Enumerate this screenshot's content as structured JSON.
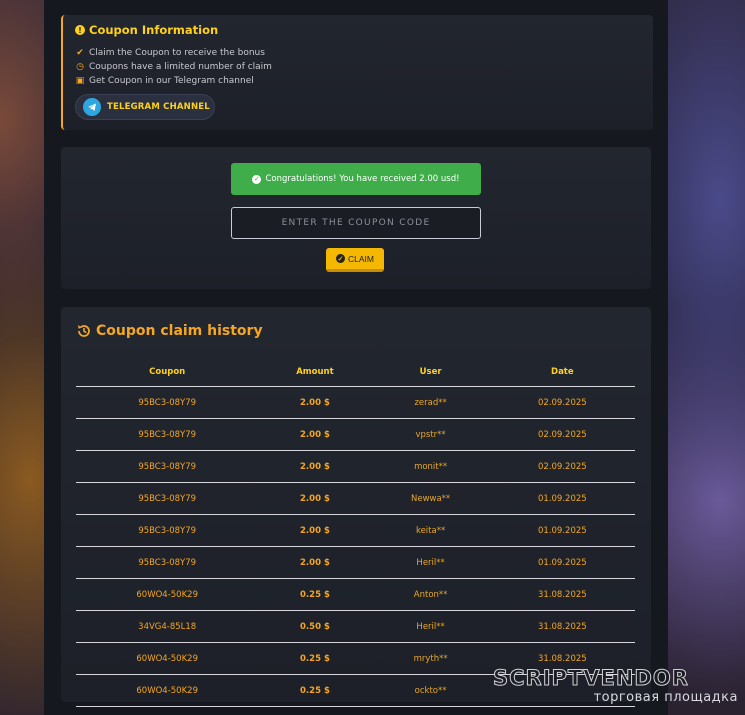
{
  "info": {
    "title": "Coupon Information",
    "lines": [
      {
        "icon": "check-circle-icon",
        "text": "Claim the Coupon to receive the bonus"
      },
      {
        "icon": "clock-icon",
        "text": "Coupons have a limited number of claim"
      },
      {
        "icon": "gift-icon",
        "text": "Get Coupon in our Telegram channel"
      }
    ],
    "telegram_button": "TELEGRAM CHANNEL"
  },
  "claim": {
    "success_message": "Congratulations! You have received 2.00 usd!",
    "input_placeholder": "ENTER THE COUPON CODE",
    "claim_label": "CLAIM"
  },
  "history": {
    "title": "Coupon claim history",
    "columns": [
      "Coupon",
      "Amount",
      "User",
      "Date"
    ],
    "rows": [
      {
        "coupon": "95BC3-08Y79",
        "amount": "2.00 $",
        "user": "zerad**",
        "date": "02.09.2025"
      },
      {
        "coupon": "95BC3-08Y79",
        "amount": "2.00 $",
        "user": "vpstr**",
        "date": "02.09.2025"
      },
      {
        "coupon": "95BC3-08Y79",
        "amount": "2.00 $",
        "user": "monit**",
        "date": "02.09.2025"
      },
      {
        "coupon": "95BC3-08Y79",
        "amount": "2.00 $",
        "user": "Newwa**",
        "date": "01.09.2025"
      },
      {
        "coupon": "95BC3-08Y79",
        "amount": "2.00 $",
        "user": "keita**",
        "date": "01.09.2025"
      },
      {
        "coupon": "95BC3-08Y79",
        "amount": "2.00 $",
        "user": "Heril**",
        "date": "01.09.2025"
      },
      {
        "coupon": "60WO4-50K29",
        "amount": "0.25 $",
        "user": "Anton**",
        "date": "31.08.2025"
      },
      {
        "coupon": "34VG4-85L18",
        "amount": "0.50 $",
        "user": "Heril**",
        "date": "31.08.2025"
      },
      {
        "coupon": "60WO4-50K29",
        "amount": "0.25 $",
        "user": "mryth**",
        "date": "31.08.2025"
      },
      {
        "coupon": "60WO4-50K29",
        "amount": "0.25 $",
        "user": "ockto**",
        "date": ""
      }
    ]
  },
  "watermark": {
    "main": "SCRIPTVENDOR",
    "sub": "торговая площадка"
  }
}
